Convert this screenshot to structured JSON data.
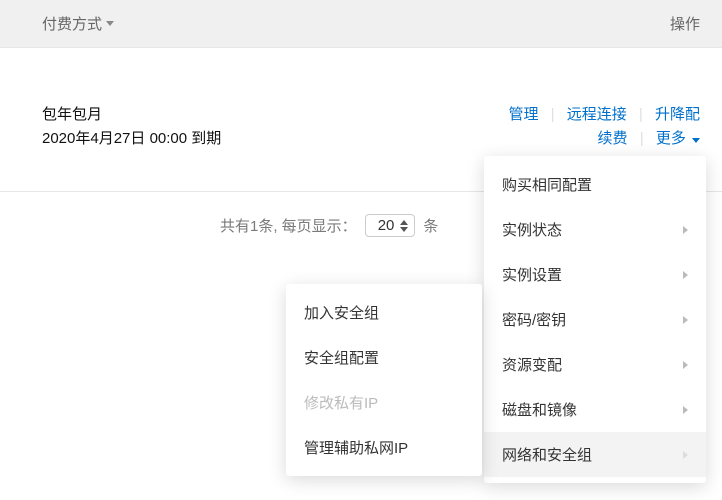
{
  "header": {
    "payment_label": "付费方式",
    "actions_label": "操作"
  },
  "row": {
    "billing_type": "包年包月",
    "expires": "2020年4月27日 00:00 到期",
    "links": {
      "manage": "管理",
      "remote": "远程连接",
      "upgrade": "升降配",
      "renew": "续费",
      "more": "更多"
    }
  },
  "pager": {
    "total_prefix": "共有1条, 每页显示：",
    "page_size": "20",
    "unit": "条"
  },
  "more_menu": {
    "items": [
      {
        "label": "购买相同配置",
        "sub": false
      },
      {
        "label": "实例状态",
        "sub": true
      },
      {
        "label": "实例设置",
        "sub": true
      },
      {
        "label": "密码/密钥",
        "sub": true
      },
      {
        "label": "资源变配",
        "sub": true
      },
      {
        "label": "磁盘和镜像",
        "sub": true
      },
      {
        "label": "网络和安全组",
        "sub": true
      }
    ]
  },
  "sub_menu": {
    "items": [
      {
        "label": "加入安全组",
        "disabled": false
      },
      {
        "label": "安全组配置",
        "disabled": false
      },
      {
        "label": "修改私有IP",
        "disabled": true
      },
      {
        "label": "管理辅助私网IP",
        "disabled": false
      }
    ]
  }
}
